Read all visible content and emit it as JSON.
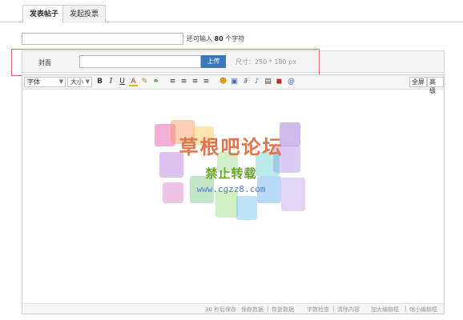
{
  "tabs": [
    {
      "label": "发表帖子",
      "active": true
    },
    {
      "label": "发起投票",
      "active": false
    }
  ],
  "subject": {
    "value": "",
    "remain_prefix": "还可输入",
    "remain_count": "80",
    "remain_suffix": "个字符"
  },
  "cover": {
    "label": "封面",
    "value": "",
    "upload_label": "上传",
    "size_hint": "尺寸：250 * 180 px"
  },
  "toolbar": {
    "font_label": "字体",
    "size_label": "大小",
    "icons": [
      {
        "name": "bold-icon",
        "glyph": "B"
      },
      {
        "name": "italic-icon",
        "glyph": "I"
      },
      {
        "name": "underline-icon",
        "glyph": "U"
      },
      {
        "name": "text-color-icon",
        "glyph": "A"
      },
      {
        "name": "highlight-icon",
        "glyph": "✎"
      },
      {
        "name": "link-icon",
        "glyph": "⚭"
      },
      {
        "name": "align-left-icon",
        "glyph": "≡"
      },
      {
        "name": "align-center-icon",
        "glyph": "≡"
      },
      {
        "name": "align-right-icon",
        "glyph": "≡"
      },
      {
        "name": "justify-icon",
        "glyph": "≡"
      },
      {
        "name": "smiley-icon",
        "glyph": "☻"
      },
      {
        "name": "image-icon",
        "glyph": "▣"
      },
      {
        "name": "attachment-icon",
        "glyph": "∂"
      },
      {
        "name": "music-icon",
        "glyph": "♪"
      },
      {
        "name": "video-icon",
        "glyph": "▤"
      },
      {
        "name": "flash-icon",
        "glyph": "◼"
      },
      {
        "name": "at-icon",
        "glyph": "@"
      }
    ],
    "fullscreen_label": "全屏",
    "advanced_label": "高级"
  },
  "watermark": {
    "title": "草根吧论坛",
    "subtitle": "禁止转载",
    "url": "www.cgzz8.com"
  },
  "statusbar": {
    "autosave": "30 秒后保存",
    "save_data": "保存数据",
    "restore_data": "恢复数据",
    "word_check": "字数检查",
    "clear_content": "清除内容",
    "enlarge": "加大编辑框",
    "shrink": "缩小编辑框"
  },
  "colors": {
    "upload_button": "#3b77b9",
    "highlight_border": "#e26a6a",
    "watermark_title": "#e0744c",
    "watermark_subtitle": "#6aa42a",
    "watermark_url": "#4a7fd0"
  }
}
